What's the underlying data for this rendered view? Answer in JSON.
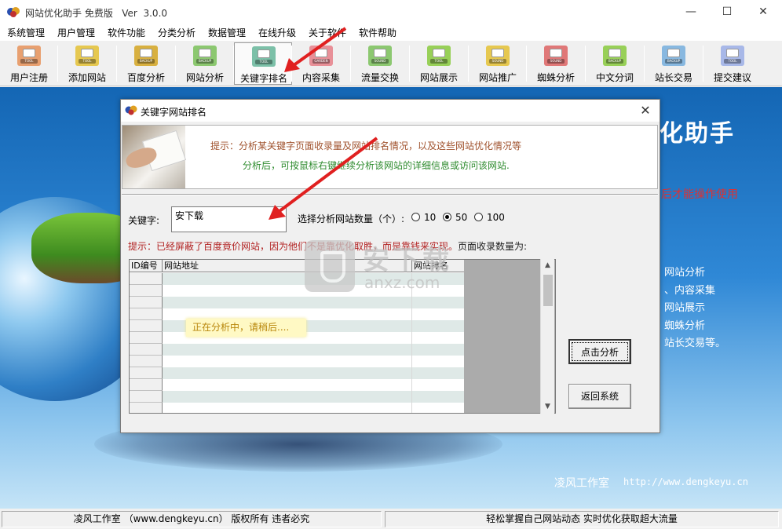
{
  "window": {
    "title": "网站优化助手 免费版   Ver  3.0.0",
    "minimize_icon": "minimize-icon",
    "maximize_icon": "maximize-icon",
    "close_icon": "close-icon"
  },
  "menubar": {
    "items": [
      "系统管理",
      "用户管理",
      "软件功能",
      "分类分析",
      "数据管理",
      "在线升级",
      "关于软件",
      "软件帮助"
    ]
  },
  "toolbar": {
    "items": [
      {
        "label": "用户注册",
        "icon": "tool-icon",
        "tag": "TOOL",
        "color": "#e8a070"
      },
      {
        "label": "添加网站",
        "icon": "tool-icon",
        "tag": "TOOL",
        "color": "#e6c850"
      },
      {
        "label": "百度分析",
        "icon": "backup-icon",
        "tag": "BACKUP",
        "color": "#d8b040"
      },
      {
        "label": "网站分析",
        "icon": "backup-icon",
        "tag": "BACKUP",
        "color": "#8cc870"
      },
      {
        "label": "关键字排名",
        "icon": "tool-icon",
        "tag": "TOOL",
        "color": "#7cc0a8"
      },
      {
        "label": "内容采集",
        "icon": "garden-icon",
        "tag": "GARDEN",
        "color": "#e89098"
      },
      {
        "label": "流量交换",
        "icon": "sound-icon",
        "tag": "SOUND",
        "color": "#8cc870"
      },
      {
        "label": "网站展示",
        "icon": "tool-icon",
        "tag": "TOOL",
        "color": "#98d058"
      },
      {
        "label": "网站推广",
        "icon": "sound-icon",
        "tag": "SOUND",
        "color": "#e6c850"
      },
      {
        "label": "蜘蛛分析",
        "icon": "sound-icon",
        "tag": "SOUND",
        "color": "#e07878"
      },
      {
        "label": "中文分词",
        "icon": "backup-icon",
        "tag": "BACKUP",
        "color": "#98d058"
      },
      {
        "label": "站长交易",
        "icon": "backup-icon",
        "tag": "BACKUP",
        "color": "#88b8e0"
      },
      {
        "label": "提交建议",
        "icon": "tool-icon",
        "tag": "TOOL",
        "color": "#a8b8e8"
      }
    ],
    "active_index": 4
  },
  "background": {
    "brand": "化助手",
    "note": "后才能操作使用",
    "features": [
      "网站分析",
      "、内容采集",
      "网站展示",
      "蜘蛛分析",
      "站长交易等。"
    ],
    "studio_name": "凌风工作室",
    "studio_url": "http://www.dengkeyu.cn"
  },
  "dialog": {
    "title": "关键字网站排名",
    "close_icon": "close-icon",
    "banner_line1": "提示：分析某关键字页面收录量及网站排名情况，以及这些网站优化情况等",
    "banner_line2": "分析后，可按鼠标右键继续分析该网站的详细信息或访问该网站.",
    "keyword_label": "关键字:",
    "keyword_value": "安下载",
    "count_label": "选择分析网站数量（个）:",
    "count_options": [
      "10",
      "50",
      "100"
    ],
    "count_selected": "50",
    "hint": "提示：已经屏蔽了百度竟价网站，因为他们不是靠优化取胜，而是靠钱来实现。",
    "hint_suffix": "页面收录数量为:",
    "table_headers": [
      "ID编号",
      "网站地址",
      "网站排名"
    ],
    "loading_text": "正在分析中，请稍后....",
    "analyze_button": "点击分析",
    "back_button": "返回系统"
  },
  "statusbar": {
    "left": "凌风工作室 （www.dengkeyu.cn） 版权所有 违者必究",
    "right": "轻松掌握自己网站动态  实时优化获取超大流量"
  },
  "watermark": {
    "cn": "安下载",
    "en": "anxz.com"
  },
  "colors": {
    "arrow": "#e02020",
    "banner_line1": "#a0522d",
    "banner_line2": "#2e8b2e",
    "hint": "#b22222",
    "feature_note": "#e03030"
  }
}
